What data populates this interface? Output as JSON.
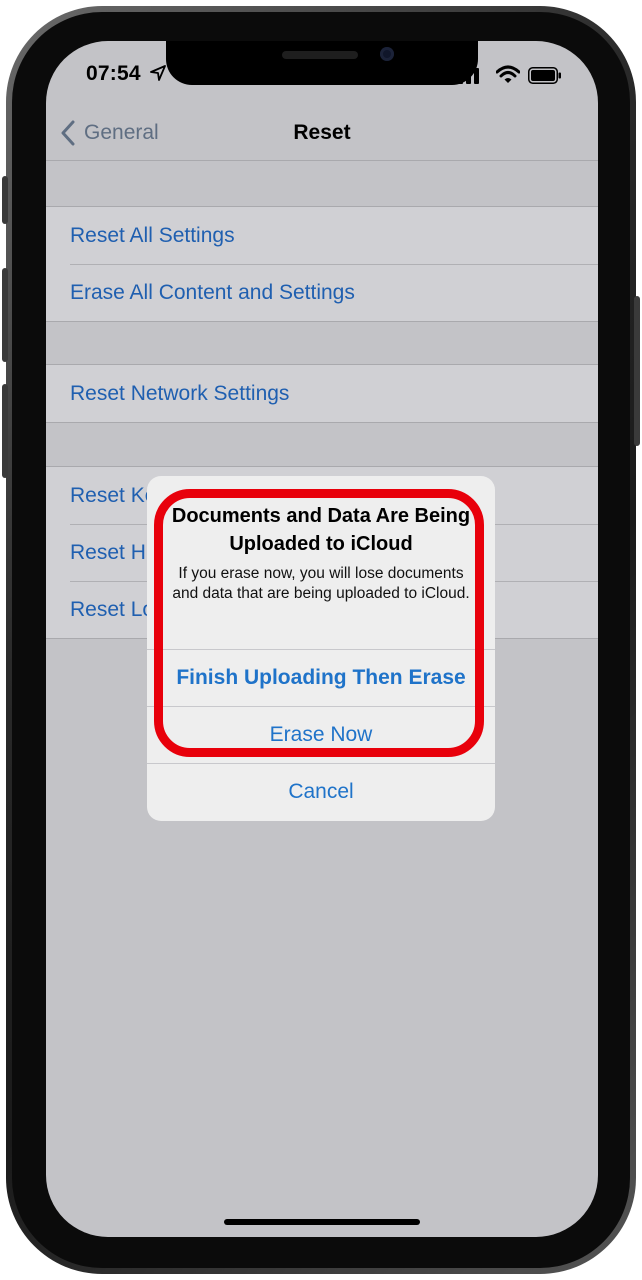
{
  "status_bar": {
    "time": "07:54",
    "location_icon": "location-arrow-icon",
    "signal_icon": "cellular-signal-icon",
    "wifi_icon": "wifi-icon",
    "battery_icon": "battery-icon"
  },
  "nav": {
    "back_label": "General",
    "title": "Reset"
  },
  "groups": [
    {
      "items": [
        "Reset All Settings",
        "Erase All Content and Settings"
      ]
    },
    {
      "items": [
        "Reset Network Settings"
      ]
    },
    {
      "items": [
        "Reset Ke",
        "Reset H",
        "Reset Lo"
      ]
    }
  ],
  "alert": {
    "title": "Documents and Data Are Being Uploaded to iCloud",
    "message": "If you erase now, you will lose documents and data that are being uploaded to iCloud.",
    "primary_action": "Finish Uploading Then Erase",
    "secondary_action": "Erase Now",
    "cancel_action": "Cancel"
  },
  "colors": {
    "link_blue": "#1f73c9",
    "highlight_red": "#e8000b",
    "dimmed_background": "#c3c3c7"
  }
}
